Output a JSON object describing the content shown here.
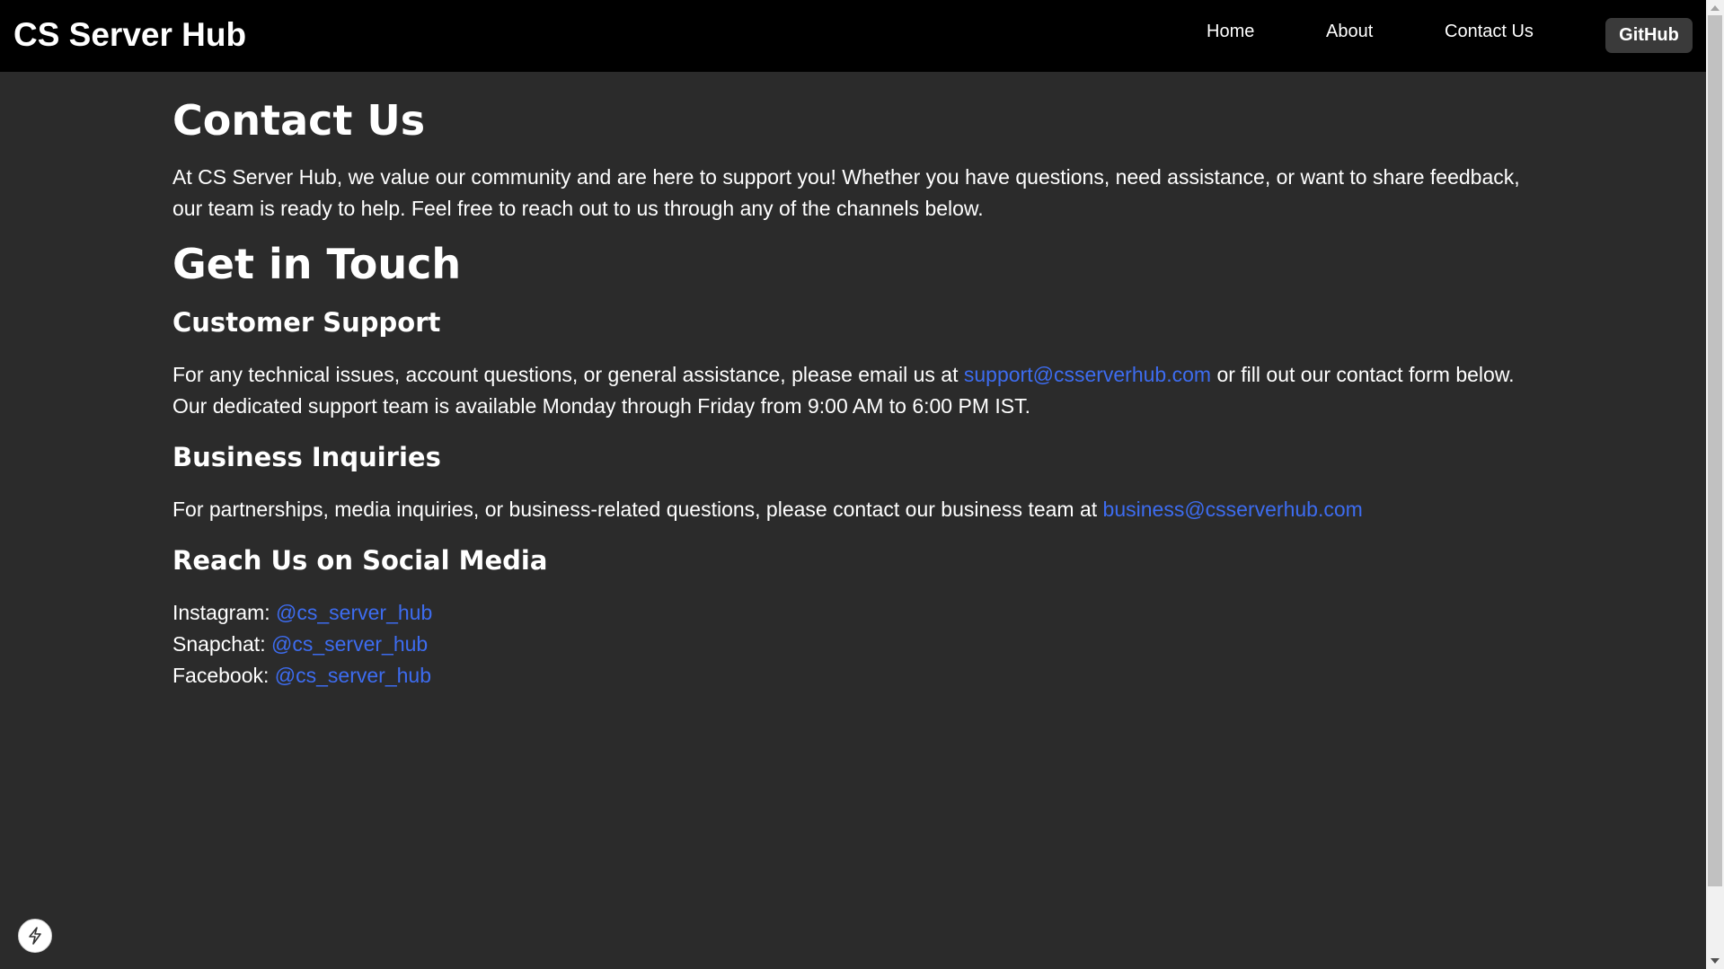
{
  "nav": {
    "brand": "CS Server Hub",
    "links": [
      "Home",
      "About",
      "Contact Us"
    ],
    "github_label": "GitHub"
  },
  "main": {
    "title": "Contact Us",
    "intro": "At CS Server Hub, we value our community and are here to support you! Whether you have questions, need assistance, or want to share feedback, our team is ready to help. Feel free to reach out to us through any of the channels below.",
    "get_in_touch": "Get in Touch",
    "support": {
      "heading": "Customer Support",
      "text_before": "For any technical issues, account questions, or general assistance, please email us at ",
      "email": "support@csserverhub.com",
      "text_after": " or fill out our contact form below. Our dedicated support team is available Monday through Friday from 9:00 AM to 6:00 PM IST."
    },
    "business": {
      "heading": "Business Inquiries",
      "text_before": "For partnerships, media inquiries, or business-related questions, please contact our business team at ",
      "email": "business@csserverhub.com"
    },
    "social": {
      "heading": "Reach Us on Social Media",
      "items": [
        {
          "label": "Instagram:",
          "handle": "@cs_server_hub"
        },
        {
          "label": "Snapchat:",
          "handle": "@cs_server_hub"
        },
        {
          "label": "Facebook:",
          "handle": "@cs_server_hub"
        }
      ]
    }
  },
  "colors": {
    "background": "#2b2b2b",
    "navbar": "#000000",
    "link": "#3d6cf0",
    "text": "#ffffff",
    "github_button": "#3a3a3a"
  },
  "icons": {
    "badge": "lightning-bolt-icon"
  }
}
